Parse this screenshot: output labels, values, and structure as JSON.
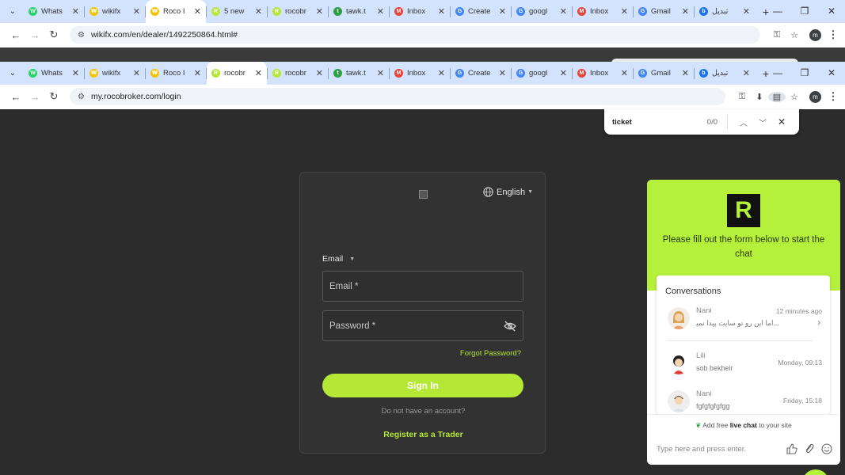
{
  "window1": {
    "tabs": [
      {
        "label": "Whats",
        "fav_color": "#25d366",
        "fav_char": "W"
      },
      {
        "label": "wikifx",
        "fav_color": "#f5c400",
        "fav_char": "₩"
      },
      {
        "label": "Roco I",
        "fav_color": "#f5c400",
        "fav_char": "₩",
        "active": true
      },
      {
        "label": "5 new",
        "fav_color": "#b5e835",
        "fav_char": "R"
      },
      {
        "label": "rocobr",
        "fav_color": "#b5e835",
        "fav_char": "R"
      },
      {
        "label": "tawk.t",
        "fav_color": "#2ea043",
        "fav_char": "t"
      },
      {
        "label": "Inbox",
        "fav_color": "#ea4335",
        "fav_char": "M"
      },
      {
        "label": "Create",
        "fav_color": "#4285f4",
        "fav_char": "G"
      },
      {
        "label": "googl",
        "fav_color": "#4285f4",
        "fav_char": "G"
      },
      {
        "label": "Inbox",
        "fav_color": "#ea4335",
        "fav_char": "M"
      },
      {
        "label": "Gmail",
        "fav_color": "#4285f4",
        "fav_char": "G"
      },
      {
        "label": "تبدیل",
        "fav_color": "#1a73e8",
        "fav_char": "b"
      }
    ],
    "url": "wikifx.com/en/dealer/1492250864.html#"
  },
  "window2": {
    "tabs": [
      {
        "label": "Whats",
        "fav_color": "#25d366",
        "fav_char": "W"
      },
      {
        "label": "wikifx",
        "fav_color": "#f5c400",
        "fav_char": "₩"
      },
      {
        "label": "Roco I",
        "fav_color": "#f5c400",
        "fav_char": "₩"
      },
      {
        "label": "rocobr",
        "fav_color": "#b5e835",
        "fav_char": "R",
        "active": true
      },
      {
        "label": "rocobr",
        "fav_color": "#b5e835",
        "fav_char": "R"
      },
      {
        "label": "tawk.t",
        "fav_color": "#2ea043",
        "fav_char": "t"
      },
      {
        "label": "Inbox",
        "fav_color": "#ea4335",
        "fav_char": "M"
      },
      {
        "label": "Create",
        "fav_color": "#4285f4",
        "fav_char": "G"
      },
      {
        "label": "googl",
        "fav_color": "#4285f4",
        "fav_char": "G"
      },
      {
        "label": "Inbox",
        "fav_color": "#ea4335",
        "fav_char": "M"
      },
      {
        "label": "Gmail",
        "fav_color": "#4285f4",
        "fav_char": "G"
      },
      {
        "label": "تبدیل",
        "fav_color": "#1a73e8",
        "fav_char": "b"
      }
    ],
    "url": "my.rocobroker.com/login"
  },
  "findbar": {
    "query": "ticket",
    "count": "0/0"
  },
  "login": {
    "language": "English",
    "mode": "Email",
    "email_placeholder": "Email *",
    "password_placeholder": "Password *",
    "forgot": "Forgot Password?",
    "signin": "Sign In",
    "no_account": "Do not have an account?",
    "register": "Register as a Trader",
    "accent": "#b5e835"
  },
  "chat": {
    "logo_letter": "R",
    "greeting": "Please fill out the form below to start the chat",
    "conversations_title": "Conversations",
    "items": [
      {
        "name": "Nani",
        "message": "...اما این رو تو سایت پیدا نمیکنم",
        "time": "12 minutes ago"
      },
      {
        "name": "Lili",
        "message": "sob bekheir",
        "time": "Monday, 09:13"
      },
      {
        "name": "Nani",
        "message": "fgfgfgfgfgg",
        "time": "Friday, 15:18"
      }
    ],
    "powered_pre": "Add free",
    "powered_bold": "live chat",
    "powered_post": "to your site",
    "input_placeholder": "Type here and press enter.",
    "accent": "#b5f03a"
  }
}
